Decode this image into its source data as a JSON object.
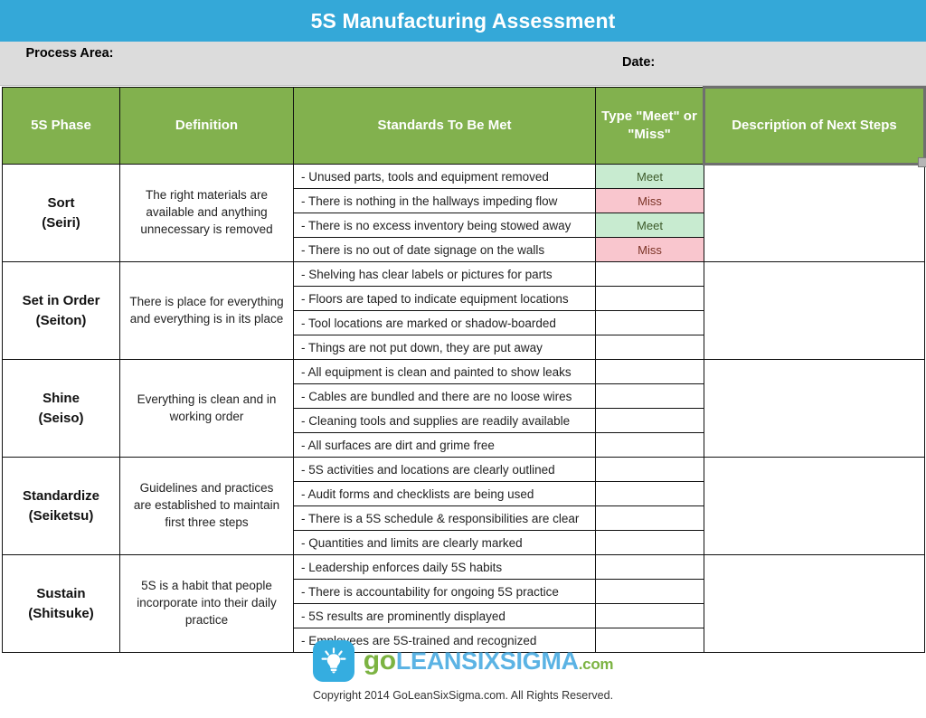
{
  "title": "5S Manufacturing Assessment",
  "colors": {
    "title_bar": "#34a8d8",
    "header_green": "#82b14e",
    "info_bar": "#dcdcdc",
    "meet_bg": "#c8ebd0",
    "miss_bg": "#f9c6ce",
    "logo_blue": "#35ade0",
    "logo_green": "#7cb342"
  },
  "info": {
    "process_area_label": "Process Area:",
    "process_area_value": "",
    "date_label": "Date:",
    "date_value": ""
  },
  "table": {
    "headers": {
      "phase": "5S Phase",
      "definition": "Definition",
      "standards": "Standards To Be Met",
      "type": "Type \"Meet\" or \"Miss\"",
      "description": "Description of Next Steps"
    },
    "sections": [
      {
        "phase": "Sort",
        "phase_jp": "(Seiri)",
        "definition": "The right materials are available and anything unnecessary is removed",
        "description": "",
        "rows": [
          {
            "standard": "- Unused parts, tools and equipment removed",
            "type": "Meet"
          },
          {
            "standard": "- There is nothing in the hallways impeding flow",
            "type": "Miss"
          },
          {
            "standard": "- There is no excess inventory being stowed away",
            "type": "Meet"
          },
          {
            "standard": "- There is no out of date signage on the walls",
            "type": "Miss"
          }
        ]
      },
      {
        "phase": "Set in Order",
        "phase_jp": "(Seiton)",
        "definition": "There is place for everything and everything is in its place",
        "description": "",
        "rows": [
          {
            "standard": "- Shelving has clear labels or pictures for parts",
            "type": ""
          },
          {
            "standard": "- Floors are taped to indicate equipment locations",
            "type": ""
          },
          {
            "standard": "- Tool locations are marked or shadow-boarded",
            "type": ""
          },
          {
            "standard": "- Things are not put down, they are put away",
            "type": ""
          }
        ]
      },
      {
        "phase": "Shine",
        "phase_jp": "(Seiso)",
        "definition": "Everything is clean and in working order",
        "description": "",
        "rows": [
          {
            "standard": "- All equipment is clean and painted to show leaks",
            "type": ""
          },
          {
            "standard": "- Cables are bundled and there are no loose wires",
            "type": ""
          },
          {
            "standard": "- Cleaning tools and supplies are readily available",
            "type": ""
          },
          {
            "standard": "- All surfaces are dirt and grime free",
            "type": ""
          }
        ]
      },
      {
        "phase": "Standardize",
        "phase_jp": "(Seiketsu)",
        "definition": "Guidelines and practices are established to maintain first three steps",
        "description": "",
        "rows": [
          {
            "standard": "- 5S activities and locations are clearly outlined",
            "type": ""
          },
          {
            "standard": "- Audit forms and checklists are being used",
            "type": ""
          },
          {
            "standard": "- There is a 5S schedule & responsibilities are clear",
            "type": ""
          },
          {
            "standard": "- Quantities and limits are clearly marked",
            "type": ""
          }
        ]
      },
      {
        "phase": "Sustain",
        "phase_jp": "(Shitsuke)",
        "definition": "5S is a habit that people incorporate into their daily practice",
        "description": "",
        "rows": [
          {
            "standard": "- Leadership enforces daily 5S habits",
            "type": ""
          },
          {
            "standard": "- There is accountability for ongoing 5S practice",
            "type": ""
          },
          {
            "standard": "- 5S results are prominently displayed",
            "type": ""
          },
          {
            "standard": "- Employees are 5S-trained and recognized",
            "type": ""
          }
        ]
      }
    ]
  },
  "footer": {
    "logo_icon": "lightbulb-icon",
    "logo_go": "go",
    "logo_lean": "LEANSIXSIGMA",
    "logo_com": ".com",
    "copyright": "Copyright 2014 GoLeanSixSigma.com. All Rights Reserved."
  }
}
